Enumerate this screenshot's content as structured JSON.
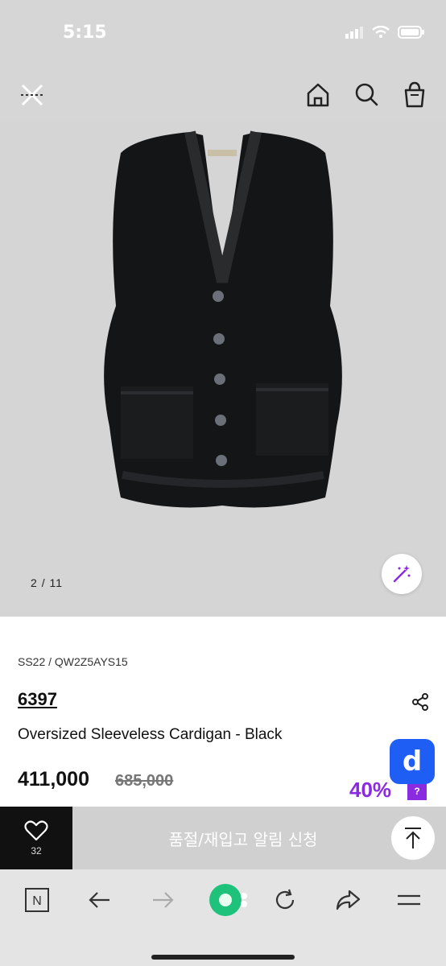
{
  "status": {
    "time": "5:15"
  },
  "gallery": {
    "current": "2",
    "separator": "/",
    "total": "11"
  },
  "product": {
    "season_code": "SS22 / QW2Z5AYS15",
    "brand": "6397",
    "name": "Oversized Sleeveless Cardigan - Black",
    "price": "411,000",
    "original_price": "685,000",
    "discount": "40%",
    "help": "?"
  },
  "floating": {
    "label": "d"
  },
  "action_bar": {
    "wish_count": "32",
    "restock_label": "품절/재입고 알림 신청"
  },
  "browser": {
    "tab_label": "N"
  },
  "colors": {
    "accent": "#8a2be2",
    "floating_button": "#1f5ef5",
    "toolbar_green": "#1ec27a"
  }
}
